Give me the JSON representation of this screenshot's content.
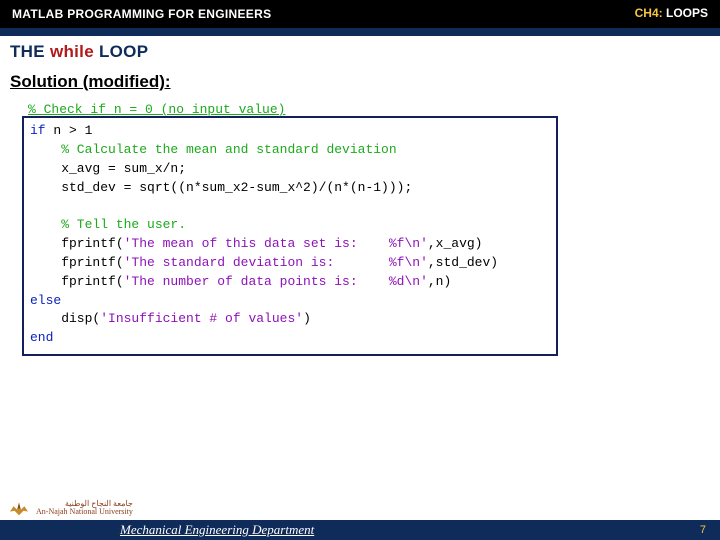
{
  "header": {
    "course": "MATLAB PROGRAMMING FOR ENGINEERS",
    "chapter_prefix": "CH4:",
    "chapter_title": "LOOPS"
  },
  "title": {
    "pre": "THE ",
    "while": "while",
    "post": " LOOP"
  },
  "subheading": "Solution (modified):",
  "code": {
    "c0": "% Check if n = 0 (no input value)",
    "l1a": "if",
    "l1b": " n > 1",
    "l2": "    % Calculate the mean and standard deviation",
    "l3": "    x_avg = sum_x/n;",
    "l4": "    std_dev = sqrt((n*sum_x2-sum_x^2)/(n*(n-1)));",
    "l6": "    % Tell the user.",
    "l7a": "    fprintf(",
    "l7s": "'The mean of this data set is:    %f\\n'",
    "l7b": ",x_avg)",
    "l8a": "    fprintf(",
    "l8s": "'The standard deviation is:       %f\\n'",
    "l8b": ",std_dev)",
    "l9a": "    fprintf(",
    "l9s": "'The number of data points is:    %d\\n'",
    "l9b": ",n)",
    "l10": "else",
    "l11a": "    disp(",
    "l11s": "'Insufficient # of values'",
    "l11b": ")",
    "l12": "end"
  },
  "footer": {
    "uni_ar": "جامعة النجاح الوطنية",
    "uni_en": "An-Najah National University",
    "dept": "Mechanical Engineering Department",
    "page": "7"
  }
}
